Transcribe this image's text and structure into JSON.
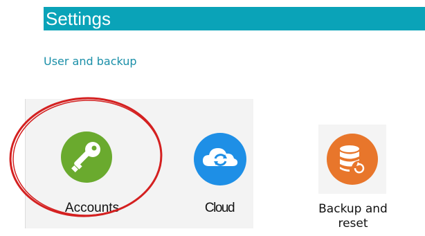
{
  "header": {
    "title": "Settings"
  },
  "section": {
    "label": "User and backup"
  },
  "tiles": [
    {
      "label": "Accounts",
      "icon": "key-icon",
      "color": "#6aaa2e"
    },
    {
      "label": "Cloud",
      "icon": "cloud-sync-icon",
      "color": "#1e8fe6"
    },
    {
      "label": "Backup and reset",
      "icon": "database-restore-icon",
      "color": "#e8762b"
    }
  ],
  "colors": {
    "header_bar": "#0aa3b8",
    "section_label": "#1a8fa8",
    "highlight_ellipse": "#d42020"
  }
}
